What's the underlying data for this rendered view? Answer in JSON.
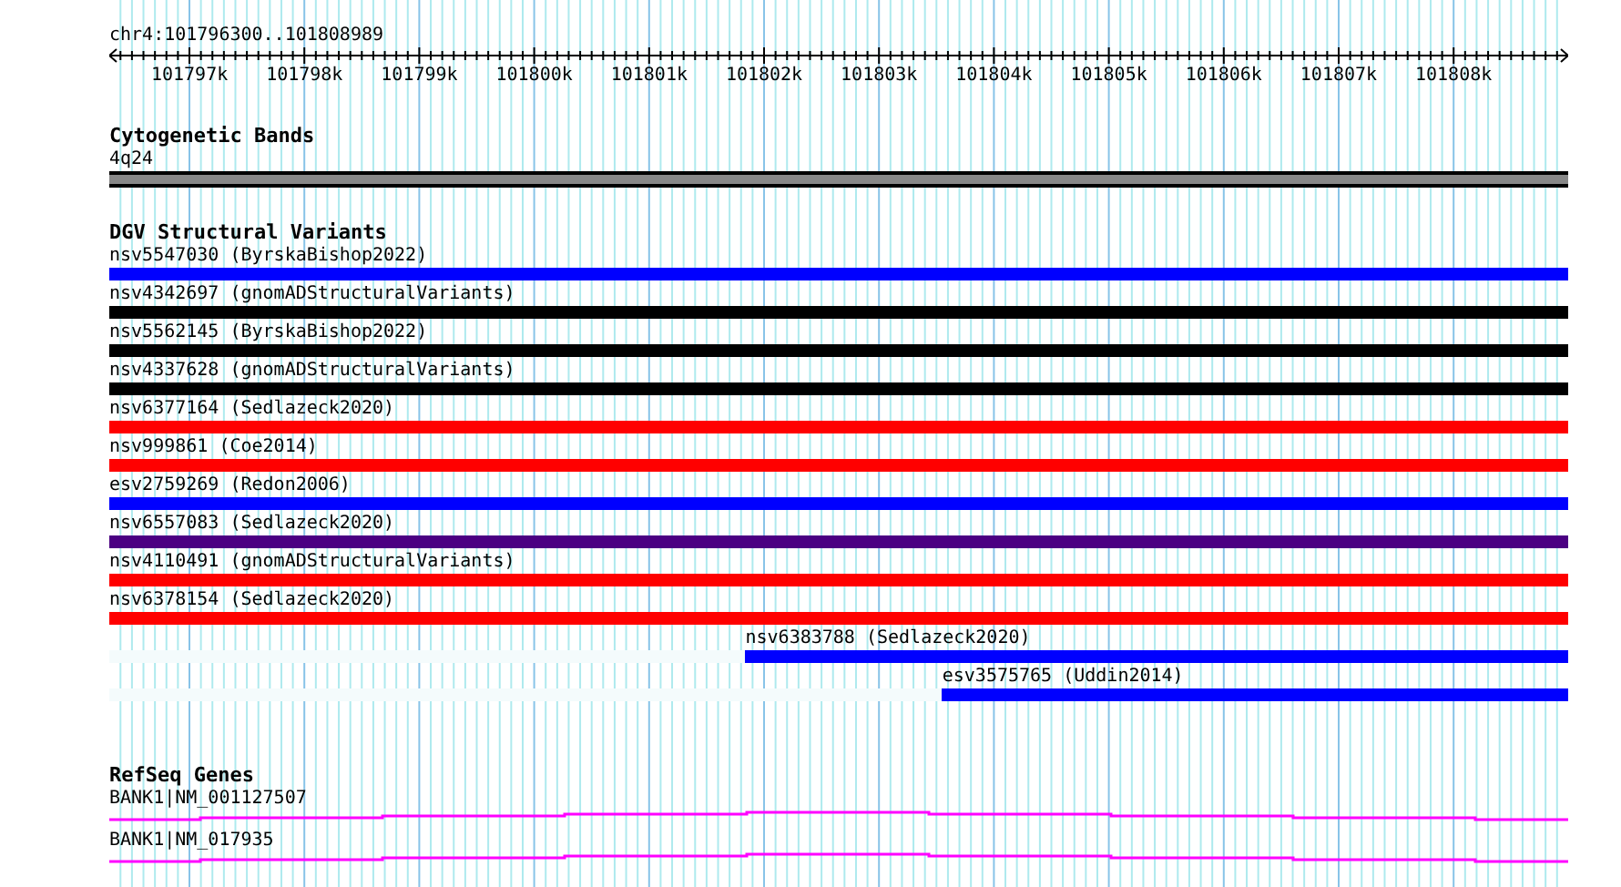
{
  "ruler": {
    "location": "chr4:101796300..101808989",
    "ticks": [
      "101797k",
      "101798k",
      "101799k",
      "101800k",
      "101801k",
      "101802k",
      "101803k",
      "101804k",
      "101805k",
      "101806k",
      "101807k",
      "101808k"
    ]
  },
  "tracks": [
    {
      "kind": "band",
      "title": "Cytogenetic Bands",
      "items": [
        {
          "label": "4q24",
          "color": "#888888"
        }
      ]
    },
    {
      "kind": "variants",
      "title": "DGV Structural Variants",
      "items": [
        {
          "label": "nsv5547030 (ByrskaBishop2022)",
          "color": "#0000ff"
        },
        {
          "label": "nsv4342697 (gnomADStructuralVariants)",
          "color": "#000000"
        },
        {
          "label": "nsv5562145 (ByrskaBishop2022)",
          "color": "#000000"
        },
        {
          "label": "nsv4337628 (gnomADStructuralVariants)",
          "color": "#000000"
        },
        {
          "label": "nsv6377164 (Sedlazeck2020)",
          "color": "#ff0000"
        },
        {
          "label": "nsv999861 (Coe2014)",
          "color": "#ff0000"
        },
        {
          "label": "esv2759269 (Redon2006)",
          "color": "#0000ff"
        },
        {
          "label": "nsv6557083 (Sedlazeck2020)",
          "color": "#4b0082"
        },
        {
          "label": "nsv4110491 (gnomADStructuralVariants)",
          "color": "#ff0000"
        },
        {
          "label": "nsv6378154 (Sedlazeck2020)",
          "color": "#ff0000"
        },
        {
          "label": "nsv6383788 (Sedlazeck2020)",
          "color": "#0000ff",
          "level": 0.564
        },
        {
          "label": "esv3575765 (Uddin2014)",
          "color": "#0000ff",
          "level": 0.429
        }
      ]
    },
    {
      "kind": "genes",
      "title": "RefSeq Genes",
      "items": [
        {
          "label": "BANK1|NM_001127507",
          "color": "#ff00ff"
        },
        {
          "label": "BANK1|NM_017935",
          "color": "#ff00ff"
        }
      ]
    }
  ]
}
